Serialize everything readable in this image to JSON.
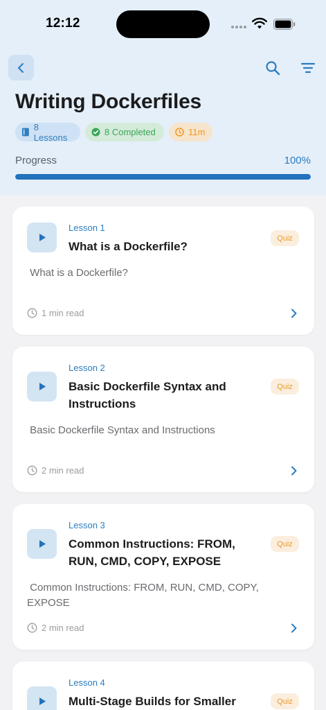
{
  "status": {
    "time": "12:12"
  },
  "course": {
    "title": "Writing Dockerfiles",
    "chips": {
      "lessons": "8 Lessons",
      "completed": "8 Completed",
      "duration": "11m"
    },
    "progress": {
      "label": "Progress",
      "value_text": "100%",
      "fraction": 1.0
    }
  },
  "colors": {
    "accent": "#2272bd",
    "completed": "#3aa65a",
    "quiz": "#eb9a2e",
    "header_bg": "#e4eff9"
  },
  "icons": [
    "back-chevron-icon",
    "search-icon",
    "filter-icon",
    "book-icon",
    "check-circle-icon",
    "clock-icon",
    "play-icon",
    "chevron-right-icon"
  ],
  "lessons": [
    {
      "number": "Lesson 1",
      "title": "What is a Dockerfile?",
      "badge": "Quiz",
      "description": "What is a Dockerfile?",
      "read_time": "1 min read"
    },
    {
      "number": "Lesson 2",
      "title": "Basic Dockerfile Syntax and Instructions",
      "badge": "Quiz",
      "description": "Basic Dockerfile Syntax and Instructions",
      "read_time": "2 min read"
    },
    {
      "number": "Lesson 3",
      "title": "Common Instructions: FROM, RUN, CMD, COPY, EXPOSE",
      "badge": "Quiz",
      "description": "Common Instructions: FROM, RUN, CMD, COPY, EXPOSE",
      "read_time": "2 min read"
    },
    {
      "number": "Lesson 4",
      "title": "Multi-Stage Builds for Smaller",
      "badge": "Quiz"
    }
  ]
}
